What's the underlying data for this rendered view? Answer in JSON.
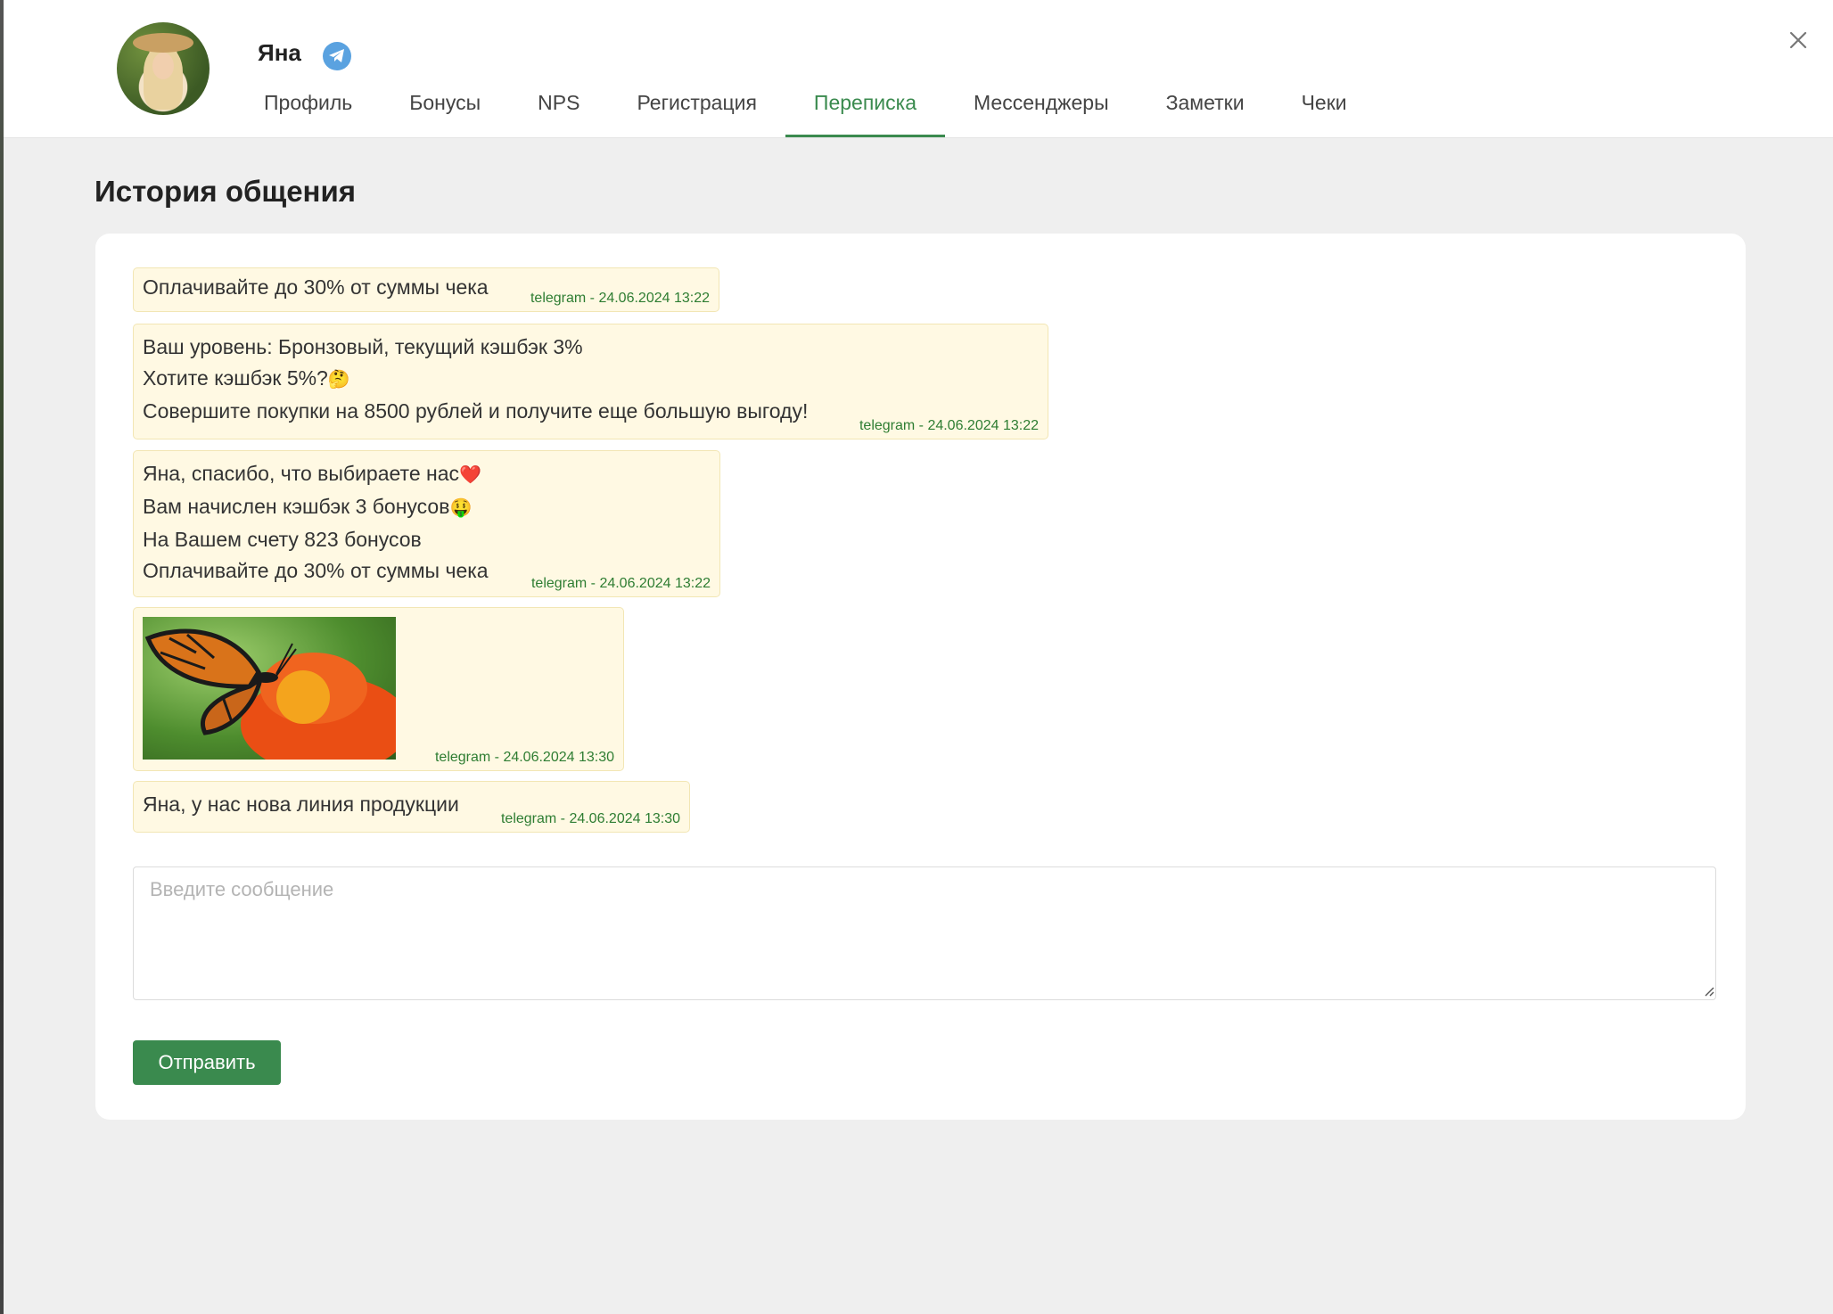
{
  "user": {
    "name": "Яна",
    "messenger_icon": "telegram-icon"
  },
  "tabs": [
    {
      "label": "Профиль",
      "active": false
    },
    {
      "label": "Бонусы",
      "active": false
    },
    {
      "label": "NPS",
      "active": false
    },
    {
      "label": "Регистрация",
      "active": false
    },
    {
      "label": "Переписка",
      "active": true
    },
    {
      "label": "Мессенджеры",
      "active": false
    },
    {
      "label": "Заметки",
      "active": false
    },
    {
      "label": "Чеки",
      "active": false
    }
  ],
  "section_title": "История общения",
  "messages": [
    {
      "text": "Оплачивайте до 30% от суммы чека",
      "meta": "telegram - 24.06.2024 13:22"
    },
    {
      "lines": [
        "Ваш уровень: Бронзовый, текущий кэшбэк 3%",
        "Хотите кэшбэк 5%?",
        "Совершите покупки на 8500 рублей и получите еще большую выгоду!"
      ],
      "emoji": [
        "",
        "🤔",
        ""
      ],
      "meta": "telegram - 24.06.2024 13:22"
    },
    {
      "lines": [
        "Яна, спасибо, что выбираете нас",
        "Вам начислен кэшбэк 3 бонусов",
        "На Вашем счету 823 бонусов",
        "Оплачивайте до 30% от суммы чека"
      ],
      "emoji": [
        "❤️",
        "🤑",
        "",
        ""
      ],
      "meta": "telegram - 24.06.2024 13:22"
    },
    {
      "image": "butterfly-on-flower-photo",
      "meta": "telegram - 24.06.2024 13:30"
    },
    {
      "text": "Яна, у нас нова линия продукции",
      "meta": "telegram - 24.06.2024 13:30"
    }
  ],
  "compose": {
    "placeholder": "Введите сообщение",
    "value": ""
  },
  "send_label": "Отправить",
  "colors": {
    "accent": "#3a8a4e",
    "message_bg": "#fff9e3",
    "meta_text": "#2e7d32",
    "page_bg": "#efefef"
  }
}
